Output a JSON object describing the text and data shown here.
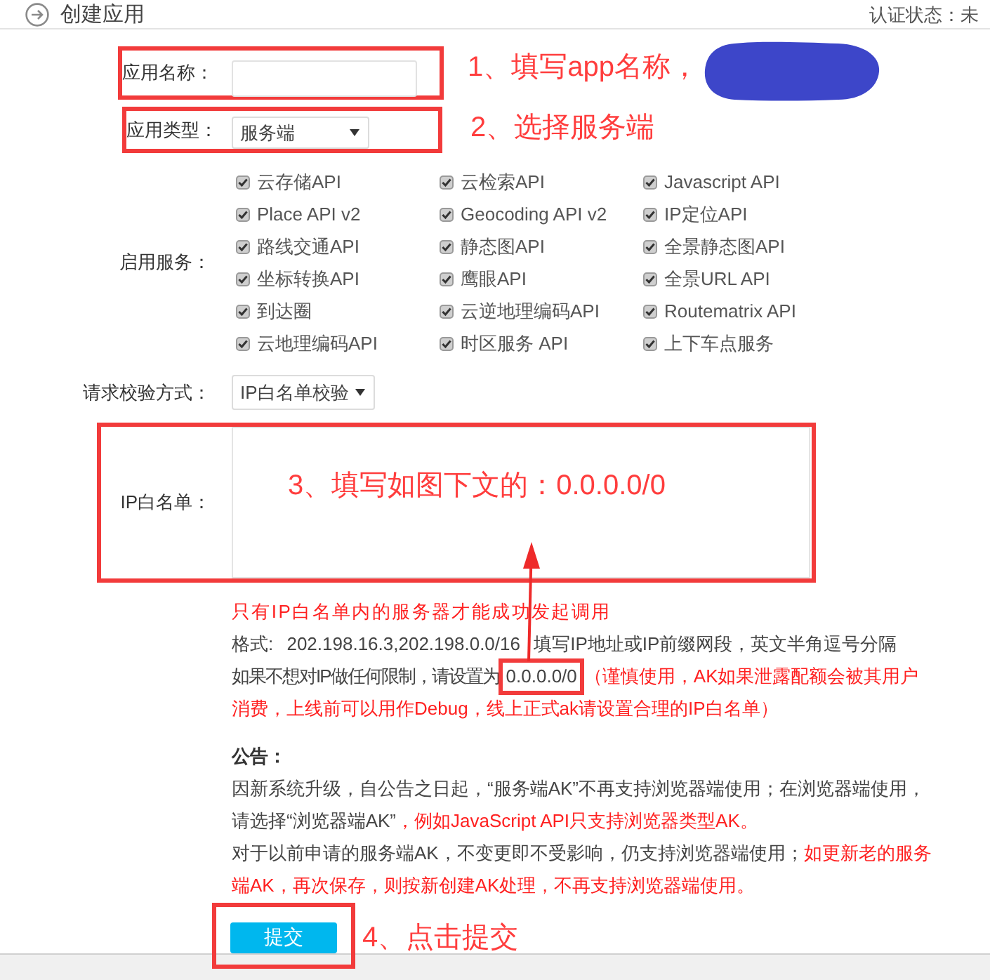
{
  "header": {
    "title": "创建应用",
    "status": "认证状态：未"
  },
  "form": {
    "app_name": {
      "label": "应用名称：",
      "annotation": "1、填写app名称，"
    },
    "app_type": {
      "label": "应用类型：",
      "value": "服务端",
      "annotation": "2、选择服务端"
    },
    "services": {
      "label": "启用服务：",
      "items": [
        {
          "label": "云存储API",
          "checked": true
        },
        {
          "label": "云检索API",
          "checked": true
        },
        {
          "label": "Javascript API",
          "checked": true
        },
        {
          "label": "Place API v2",
          "checked": true
        },
        {
          "label": "Geocoding API v2",
          "checked": true
        },
        {
          "label": "IP定位API",
          "checked": true
        },
        {
          "label": "路线交通API",
          "checked": true
        },
        {
          "label": "静态图API",
          "checked": true
        },
        {
          "label": "全景静态图API",
          "checked": true
        },
        {
          "label": "坐标转换API",
          "checked": true
        },
        {
          "label": "鹰眼API",
          "checked": true
        },
        {
          "label": "全景URL API",
          "checked": true
        },
        {
          "label": "到达圈",
          "checked": true
        },
        {
          "label": "云逆地理编码API",
          "checked": true
        },
        {
          "label": "Routematrix API",
          "checked": true
        },
        {
          "label": "云地理编码API",
          "checked": true
        },
        {
          "label": "时区服务 API",
          "checked": true
        },
        {
          "label": "上下车点服务",
          "checked": true
        }
      ]
    },
    "check_method": {
      "label": "请求校验方式：",
      "value": "IP白名单校验"
    },
    "ip_whitelist": {
      "label": "IP白名单：",
      "annotation": "3、填写如图下文的：0.0.0.0/0"
    },
    "hints": [
      [
        {
          "kind": "warning",
          "text": "只有IP白名单内的服务器才能成功发起调用"
        }
      ],
      [
        {
          "kind": "plain",
          "text": "格式: 202.198.16.3,202.198.0.0/16 填写IP地址或IP前缀网段，英文半角逗号分隔"
        }
      ],
      [
        {
          "kind": "plain",
          "text": "如果不想对IP做任何限制，请设置为"
        },
        {
          "kind": "boxed",
          "text": "0.0.0.0/0"
        },
        {
          "kind": "warning",
          "text": "（谨慎使用，AK如果泄露配额会被其用户"
        }
      ],
      [
        {
          "kind": "warning",
          "text": "消费，上线前可以用作Debug，线上正式ak请设置合理的IP白名单）"
        }
      ]
    ],
    "notice": {
      "title": "公告：",
      "lines": [
        [
          {
            "kind": "plain",
            "text": "因新系统升级，自公告之日起，“服务端AK”不再支持浏览器端使用；在浏览器端使用，"
          }
        ],
        [
          {
            "kind": "plain",
            "text": "请选择“浏览器端AK”"
          },
          {
            "kind": "warning",
            "text": "，例如JavaScript API只支持浏览器类型AK。"
          }
        ],
        [
          {
            "kind": "plain",
            "text": "对于以前申请的服务端AK，不变更即不受影响，仍支持浏览器端使用；"
          },
          {
            "kind": "warning",
            "text": "如更新老的服务"
          }
        ],
        [
          {
            "kind": "warning",
            "text": "端AK，再次保存，则按新创建AK处理，不再支持浏览器端使用。"
          }
        ]
      ]
    },
    "submit": {
      "label": "提交",
      "annotation": "4、点击提交"
    }
  }
}
